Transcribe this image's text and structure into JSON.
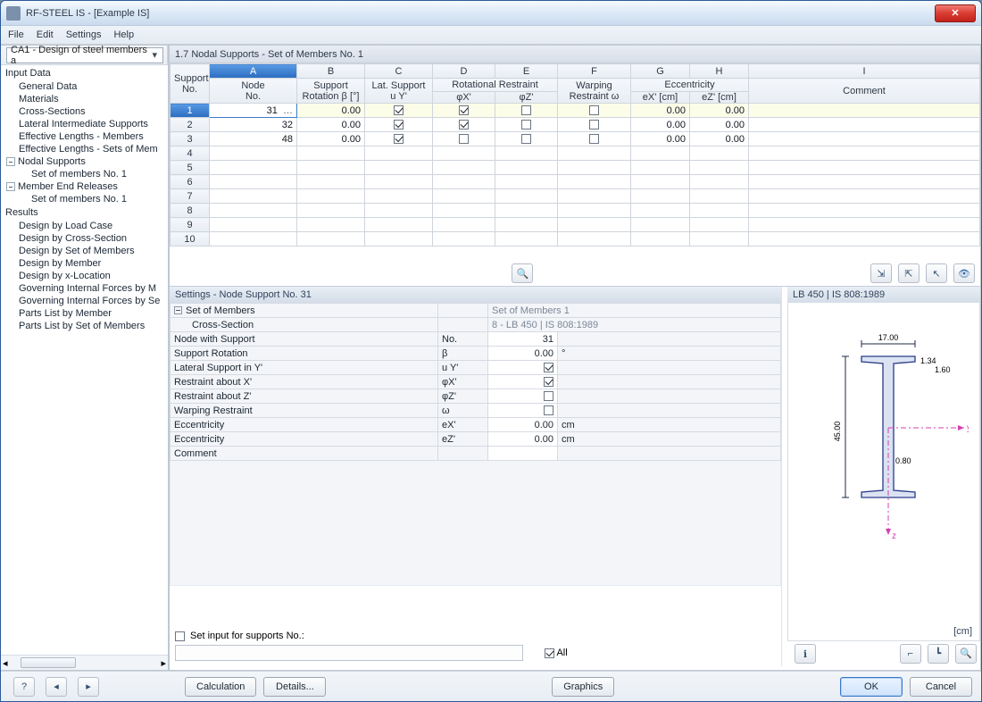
{
  "window": {
    "title": "RF-STEEL IS - [Example IS]"
  },
  "menu": {
    "file": "File",
    "edit": "Edit",
    "settings": "Settings",
    "help": "Help"
  },
  "toolbar_combo": "CA1 - Design of steel members a",
  "main_title": "1.7 Nodal Supports - Set of Members No. 1",
  "nav": {
    "input_data": "Input Data",
    "general": "General Data",
    "materials": "Materials",
    "cs": "Cross-Sections",
    "lis": "Lateral Intermediate Supports",
    "elm": "Effective Lengths - Members",
    "els": "Effective Lengths - Sets of Mem",
    "nodal": "Nodal Supports",
    "sm1": "Set of members No. 1",
    "mer": "Member End Releases",
    "sm1b": "Set of members No. 1",
    "results": "Results",
    "dlc": "Design by Load Case",
    "dcs": "Design by Cross-Section",
    "dsm": "Design by Set of Members",
    "dm": "Design by Member",
    "dxl": "Design by x-Location",
    "gifm": "Governing Internal Forces by M",
    "gifs": "Governing Internal Forces by Se",
    "plm": "Parts List by Member",
    "plsm": "Parts List by Set of Members"
  },
  "grid": {
    "cols": {
      "supno": "Support\nNo.",
      "A": "A",
      "B": "B",
      "C": "C",
      "D": "D",
      "E": "E",
      "F": "F",
      "G": "G",
      "H": "H",
      "I": "I",
      "node": "Node\nNo.",
      "rot": "Support\nRotation β [°]",
      "lat": "Lat. Support\nu Y'",
      "rr": "Rotational Restraint",
      "phix": "φX'",
      "phiz": "φZ'",
      "warp": "Warping\nRestraint ω",
      "ecc": "Eccentricity",
      "ex": "eX' [cm]",
      "ez": "eZ' [cm]",
      "comment": "Comment"
    },
    "rows": [
      {
        "n": "1",
        "node": "31",
        "rot": "0.00",
        "uy": true,
        "phix": true,
        "phiz": false,
        "warp": false,
        "ex": "0.00",
        "ez": "0.00"
      },
      {
        "n": "2",
        "node": "32",
        "rot": "0.00",
        "uy": true,
        "phix": true,
        "phiz": false,
        "warp": false,
        "ex": "0.00",
        "ez": "0.00"
      },
      {
        "n": "3",
        "node": "48",
        "rot": "0.00",
        "uy": true,
        "phix": false,
        "phiz": false,
        "warp": false,
        "ex": "0.00",
        "ez": "0.00"
      }
    ]
  },
  "settings": {
    "title": "Settings - Node Support No. 31",
    "set_lbl": "Set of Members",
    "set_val": "Set of Members 1",
    "cs_lbl": "Cross-Section",
    "cs_val": "8 - LB 450 | IS 808:1989",
    "node_lbl": "Node with Support",
    "node_sym": "No.",
    "node_val": "31",
    "rot_lbl": "Support Rotation",
    "rot_sym": "β",
    "rot_val": "0.00",
    "rot_unit": "°",
    "lat_lbl": "Lateral Support in Y'",
    "lat_sym": "u Y'",
    "lat_chk": true,
    "rx_lbl": "Restraint about X'",
    "rx_sym": "φX'",
    "rx_chk": true,
    "rz_lbl": "Restraint about Z'",
    "rz_sym": "φZ'",
    "rz_chk": false,
    "wr_lbl": "Warping Restraint",
    "wr_sym": "ω",
    "wr_chk": false,
    "ex_lbl": "Eccentricity",
    "ex_sym": "eX'",
    "ex_val": "0.00",
    "ex_unit": "cm",
    "ez_lbl": "Eccentricity",
    "ez_sym": "eZ'",
    "ez_val": "0.00",
    "ez_unit": "cm",
    "cm_lbl": "Comment",
    "foot_chk": "Set input for supports No.:",
    "foot_all": "All"
  },
  "preview": {
    "title": "LB 450 | IS 808:1989",
    "unit": "[cm]",
    "dim_w": "17.00",
    "dim_h": "45.00",
    "dim_tf": "1.34",
    "dim_tw": "0.80",
    "dim_r": "1.60",
    "axis_y": "y",
    "axis_z": "z"
  },
  "buttons": {
    "calc": "Calculation",
    "details": "Details...",
    "graphics": "Graphics",
    "ok": "OK",
    "cancel": "Cancel"
  }
}
